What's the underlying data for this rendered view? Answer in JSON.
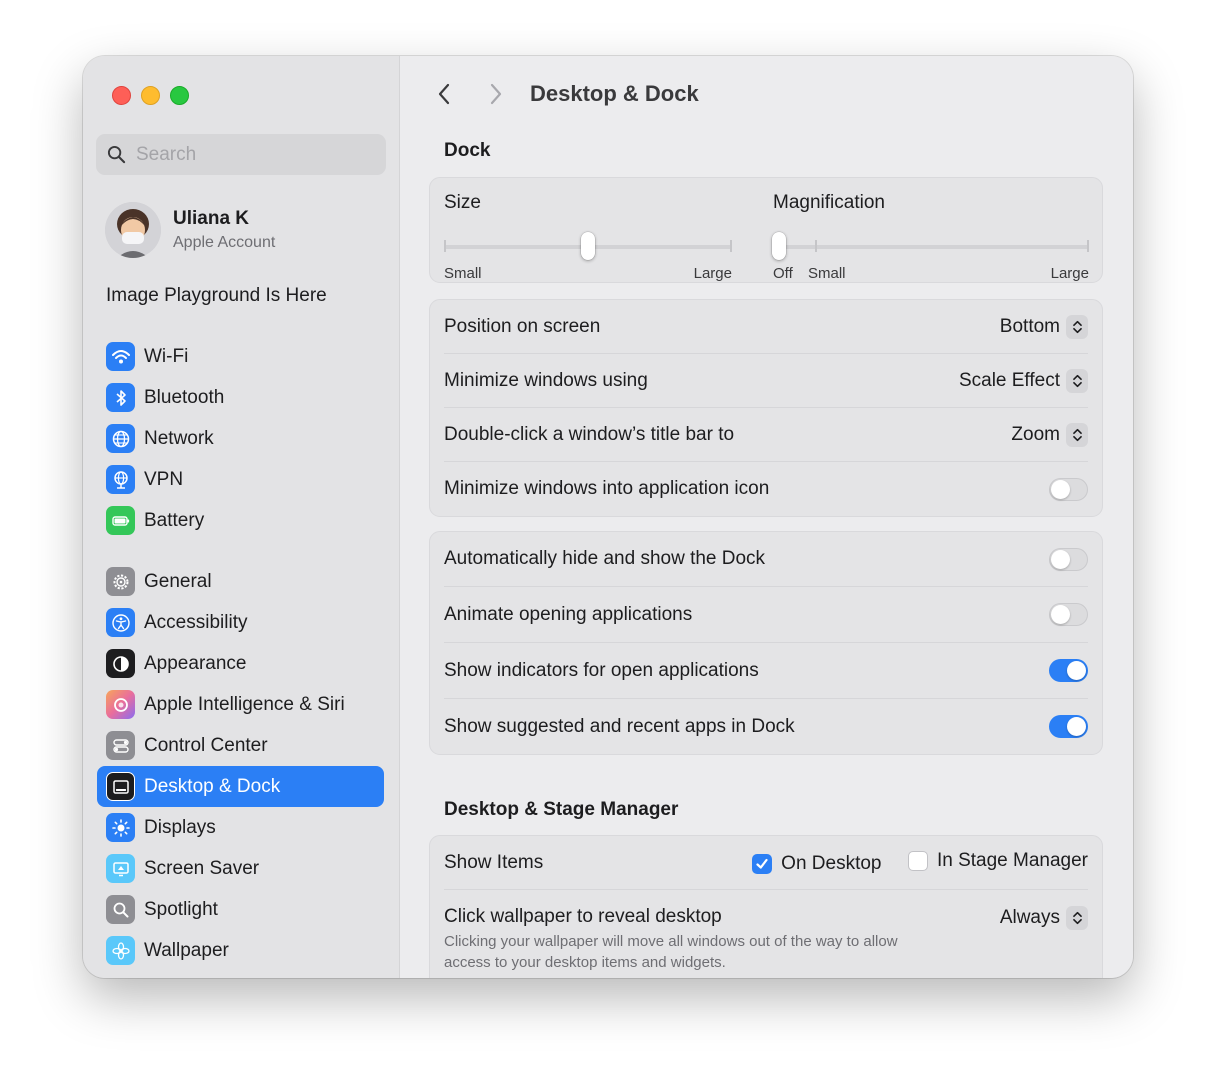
{
  "window": {
    "title": "Desktop & Dock"
  },
  "sidebar": {
    "search_placeholder": "Search",
    "account": {
      "name": "Uliana K",
      "subtitle": "Apple Account"
    },
    "promo": "Image Playground Is Here",
    "groups": [
      [
        {
          "label": "Wi-Fi",
          "icon": "wifi-icon",
          "color": "#2b7ff5"
        },
        {
          "label": "Bluetooth",
          "icon": "bluetooth-icon",
          "color": "#2b7ff5"
        },
        {
          "label": "Network",
          "icon": "globe-icon",
          "color": "#2b7ff5"
        },
        {
          "label": "VPN",
          "icon": "vpn-globe-icon",
          "color": "#2b7ff5"
        },
        {
          "label": "Battery",
          "icon": "battery-icon",
          "color": "#34c759"
        }
      ],
      [
        {
          "label": "General",
          "icon": "gear-icon",
          "color": "#8e8e93"
        },
        {
          "label": "Accessibility",
          "icon": "accessibility-icon",
          "color": "#2b7ff5"
        },
        {
          "label": "Appearance",
          "icon": "appearance-icon",
          "color": "#1d1d1f"
        },
        {
          "label": "Apple Intelligence & Siri",
          "icon": "siri-icon",
          "color": "#e96e9c"
        },
        {
          "label": "Control Center",
          "icon": "control-center-icon",
          "color": "#8e8e93"
        },
        {
          "label": "Desktop & Dock",
          "icon": "dock-icon",
          "color": "#1d1d1f",
          "active": true
        },
        {
          "label": "Displays",
          "icon": "sun-icon",
          "color": "#2b7ff5"
        },
        {
          "label": "Screen Saver",
          "icon": "screen-saver-icon",
          "color": "#5ac8fa"
        },
        {
          "label": "Spotlight",
          "icon": "magnifier-icon",
          "color": "#8e8e93"
        },
        {
          "label": "Wallpaper",
          "icon": "flower-icon",
          "color": "#5ac8fa"
        }
      ]
    ]
  },
  "main": {
    "dock_section": "Dock",
    "size": {
      "label": "Size",
      "min_label": "Small",
      "max_label": "Large",
      "value": 0.5
    },
    "magnification": {
      "label": "Magnification",
      "off_label": "Off",
      "min_label": "Small",
      "max_label": "Large",
      "value": 0
    },
    "group2": [
      {
        "label": "Position on screen",
        "type": "popup",
        "value": "Bottom"
      },
      {
        "label": "Minimize windows using",
        "type": "popup",
        "value": "Scale Effect"
      },
      {
        "label": "Double-click a window’s title bar to",
        "type": "popup",
        "value": "Zoom"
      },
      {
        "label": "Minimize windows into application icon",
        "type": "toggle",
        "value": false
      }
    ],
    "group3": [
      {
        "label": "Automatically hide and show the Dock",
        "type": "toggle",
        "value": false
      },
      {
        "label": "Animate opening applications",
        "type": "toggle",
        "value": false
      },
      {
        "label": "Show indicators for open applications",
        "type": "toggle",
        "value": true
      },
      {
        "label": "Show suggested and recent apps in Dock",
        "type": "toggle",
        "value": true
      }
    ],
    "stage_section": "Desktop & Stage Manager",
    "show_items": {
      "label": "Show Items",
      "on_desktop": "On Desktop",
      "on_desktop_checked": true,
      "stage_manager": "In Stage Manager",
      "stage_manager_checked": false
    },
    "click_wallpaper": {
      "label": "Click wallpaper to reveal desktop",
      "value": "Always",
      "description": "Clicking your wallpaper will move all windows out of the way to allow access to your desktop items and widgets."
    }
  }
}
